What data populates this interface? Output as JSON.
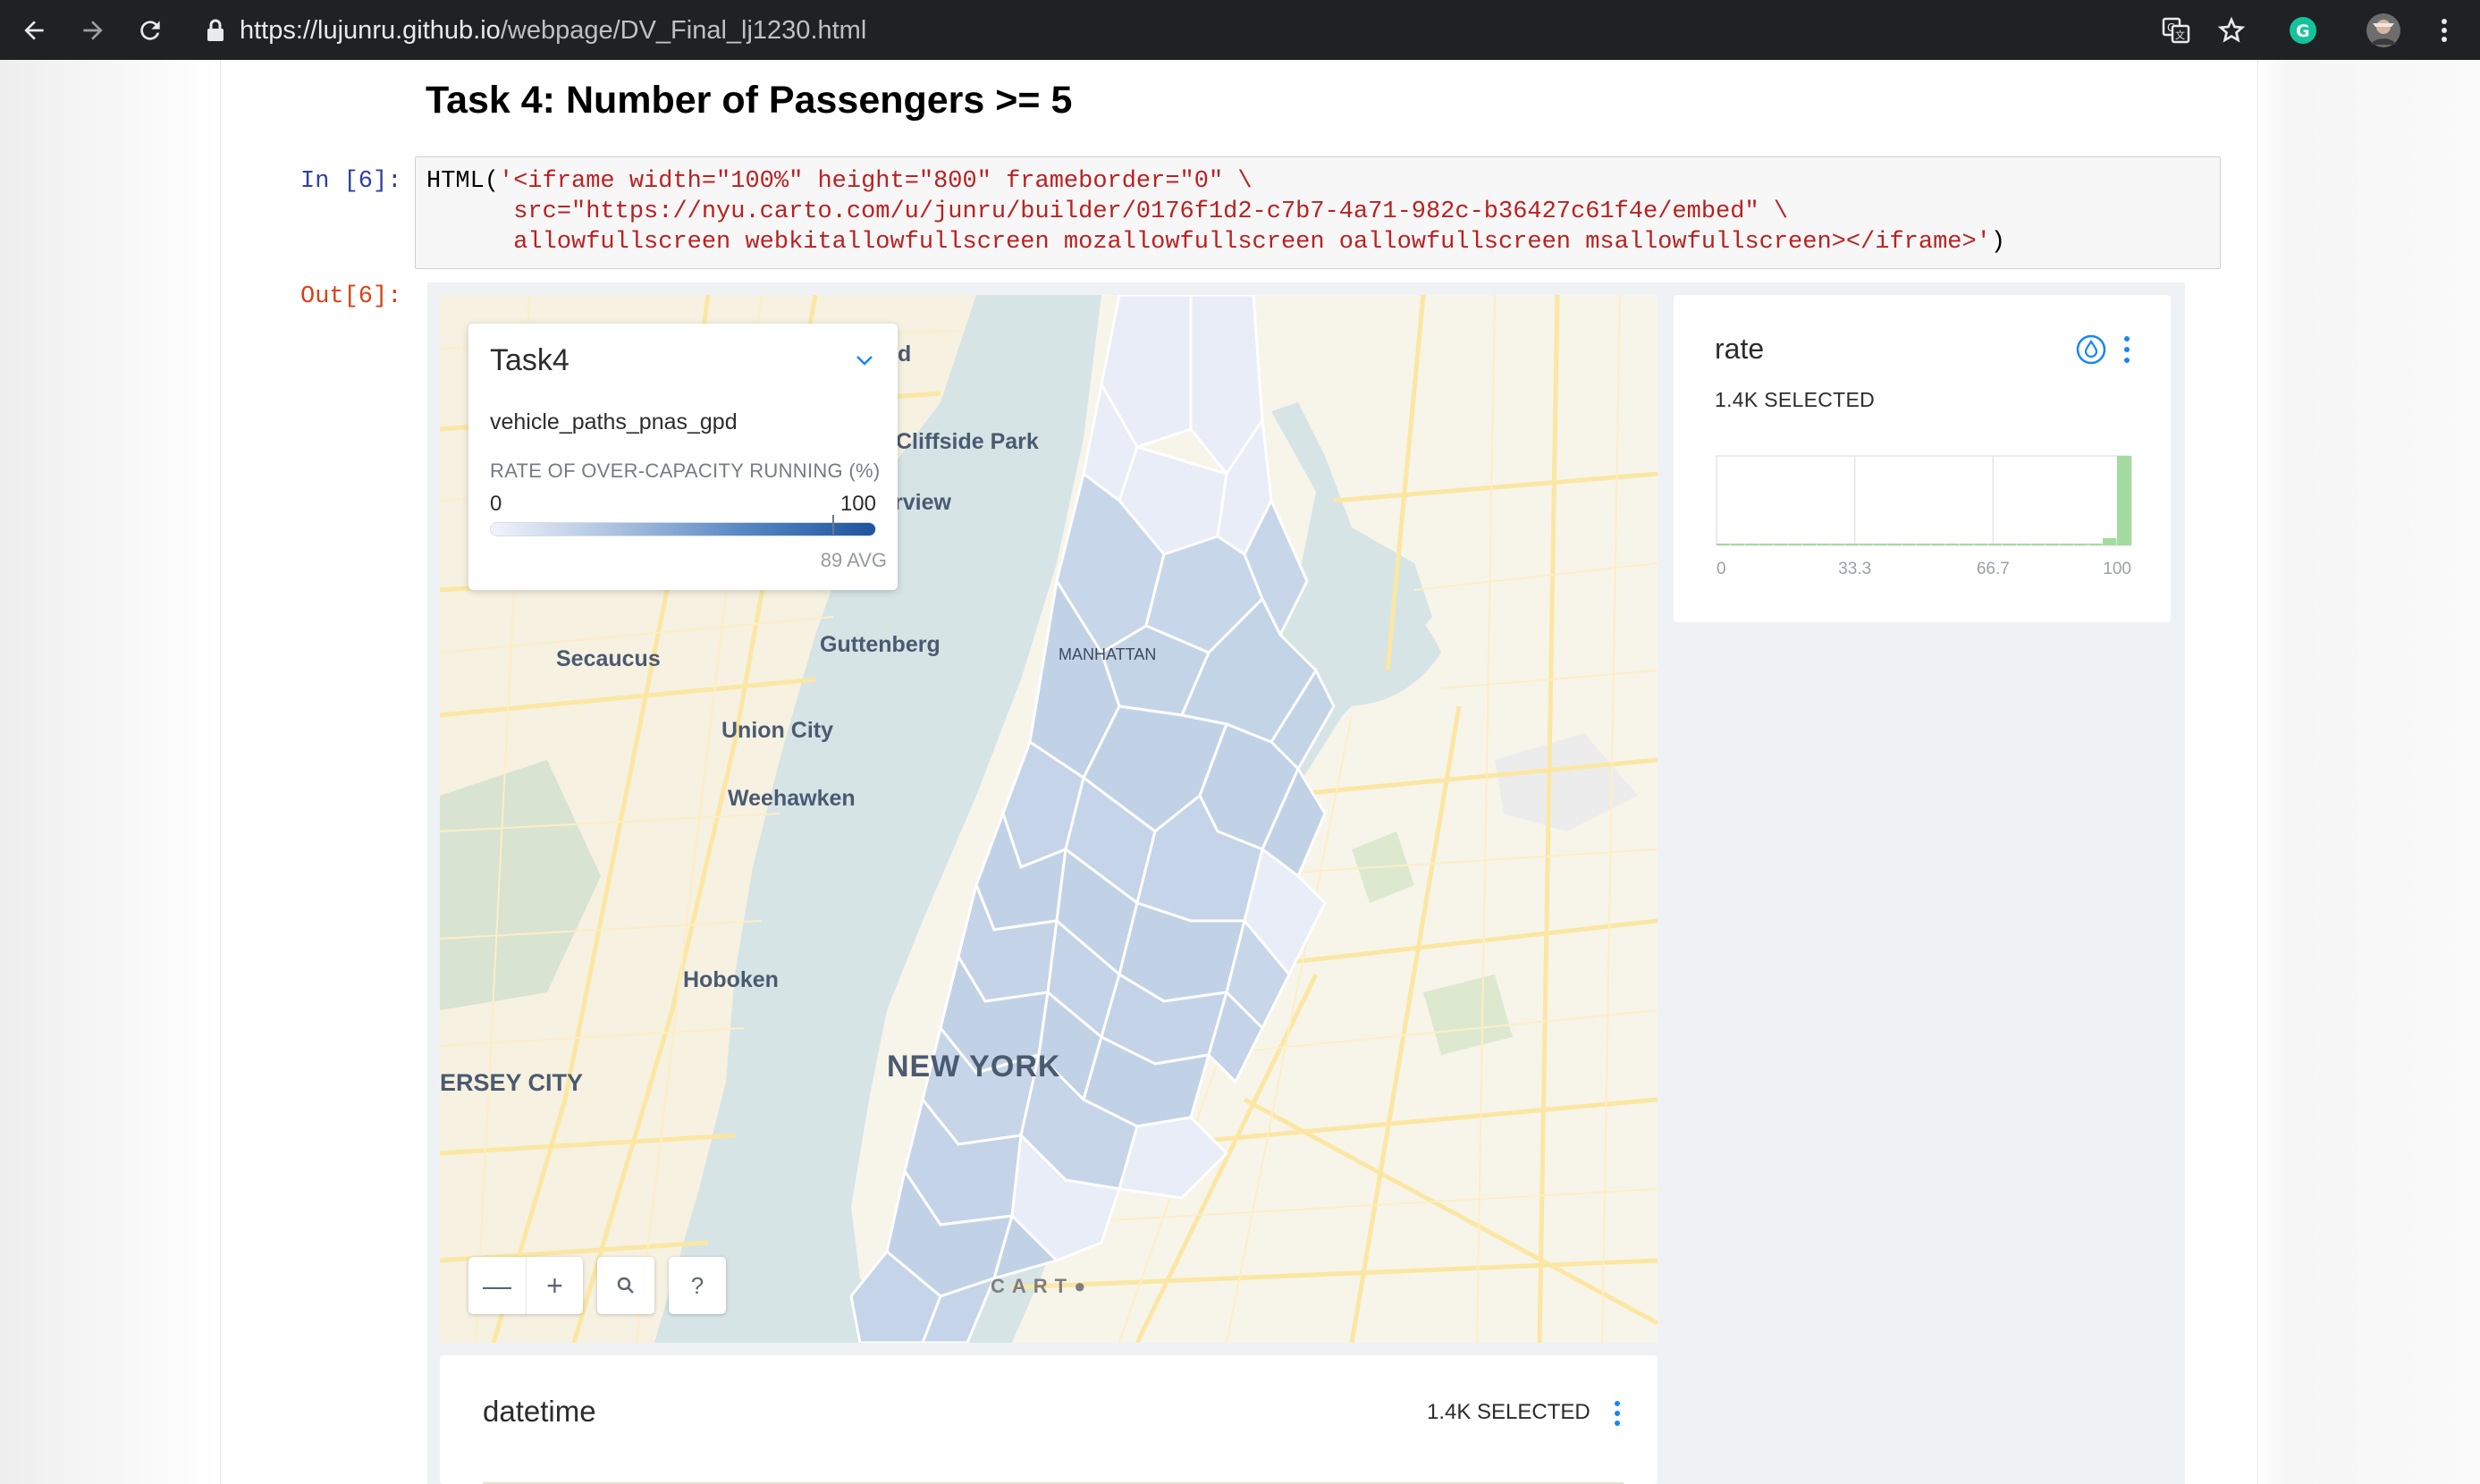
{
  "browser": {
    "url_host": "https://lujunru.github.io",
    "url_path": "/webpage/DV_Final_lj1230.html",
    "icons": [
      "back-arrow-icon",
      "forward-arrow-icon",
      "reload-icon",
      "lock-icon",
      "translate-icon",
      "star-icon",
      "grammarly-icon",
      "profile-avatar",
      "more-vert-icon"
    ]
  },
  "notebook": {
    "heading": "Task 4: Number of Passengers >= 5",
    "in_prompt": "In [6]:",
    "out_prompt": "Out[6]:",
    "code": {
      "line1_fn": "HTML(",
      "line1_str": "'<iframe width=\"100%\" height=\"800\" frameborder=\"0\" \\",
      "line2_str": "      src=\"https://nyu.carto.com/u/junru/builder/0176f1d2-c7b7-4a71-982c-b36427c61f4e/embed\" \\",
      "line3_str": "      allowfullscreen webkitallowfullscreen mozallowfullscreen oallowfullscreen msallowfullscreen></iframe>'",
      "line3_close": ")"
    }
  },
  "map": {
    "labels": {
      "cliffside": "Cliffside Park",
      "fragment_d": "d",
      "fragment_rview": "rview",
      "secaucus": "Secaucus",
      "guttenberg": "Guttenberg",
      "manhattan": "MANHATTAN",
      "union_city": "Union City",
      "weehawken": "Weehawken",
      "hoboken": "Hoboken",
      "new_york": "NEW YORK",
      "jersey_city": "ERSEY CITY"
    },
    "legend": {
      "title": "Task4",
      "layer": "vehicle_paths_pnas_gpd",
      "variable": "RATE OF OVER-CAPACITY RUNNING (%)",
      "min": "0",
      "max": "100",
      "avg_label": "89 AVG",
      "avg_value": 89,
      "colors": [
        "#f1f4fb",
        "#a9c0de",
        "#5486c2",
        "#1e549c"
      ]
    },
    "controls": {
      "zoom_out": "—",
      "zoom_in": "+",
      "help": "?"
    },
    "attribution": "CART●",
    "colors": {
      "water": "#d6e4e6",
      "land": "#f7f4ea",
      "road": "#fce7a6",
      "zone": "#c5d5e8",
      "zone_light": "#e8edf7"
    }
  },
  "rate_widget": {
    "title": "rate",
    "selected": "1.4K SELECTED",
    "color": "#a3dba0",
    "chart_data": {
      "type": "bar",
      "xlim": [
        0,
        100
      ],
      "ticks": [
        "0",
        "33.3",
        "66.7",
        "100"
      ],
      "bins": [
        2,
        1,
        1,
        1,
        1,
        1,
        1,
        1,
        1,
        1,
        1,
        1,
        1,
        1,
        1,
        1,
        1,
        1,
        1,
        1,
        1,
        1,
        1,
        1,
        1,
        1,
        1,
        8,
        100
      ],
      "grid": true
    }
  },
  "datetime_widget": {
    "title": "datetime",
    "selected": "1.4K SELECTED"
  }
}
